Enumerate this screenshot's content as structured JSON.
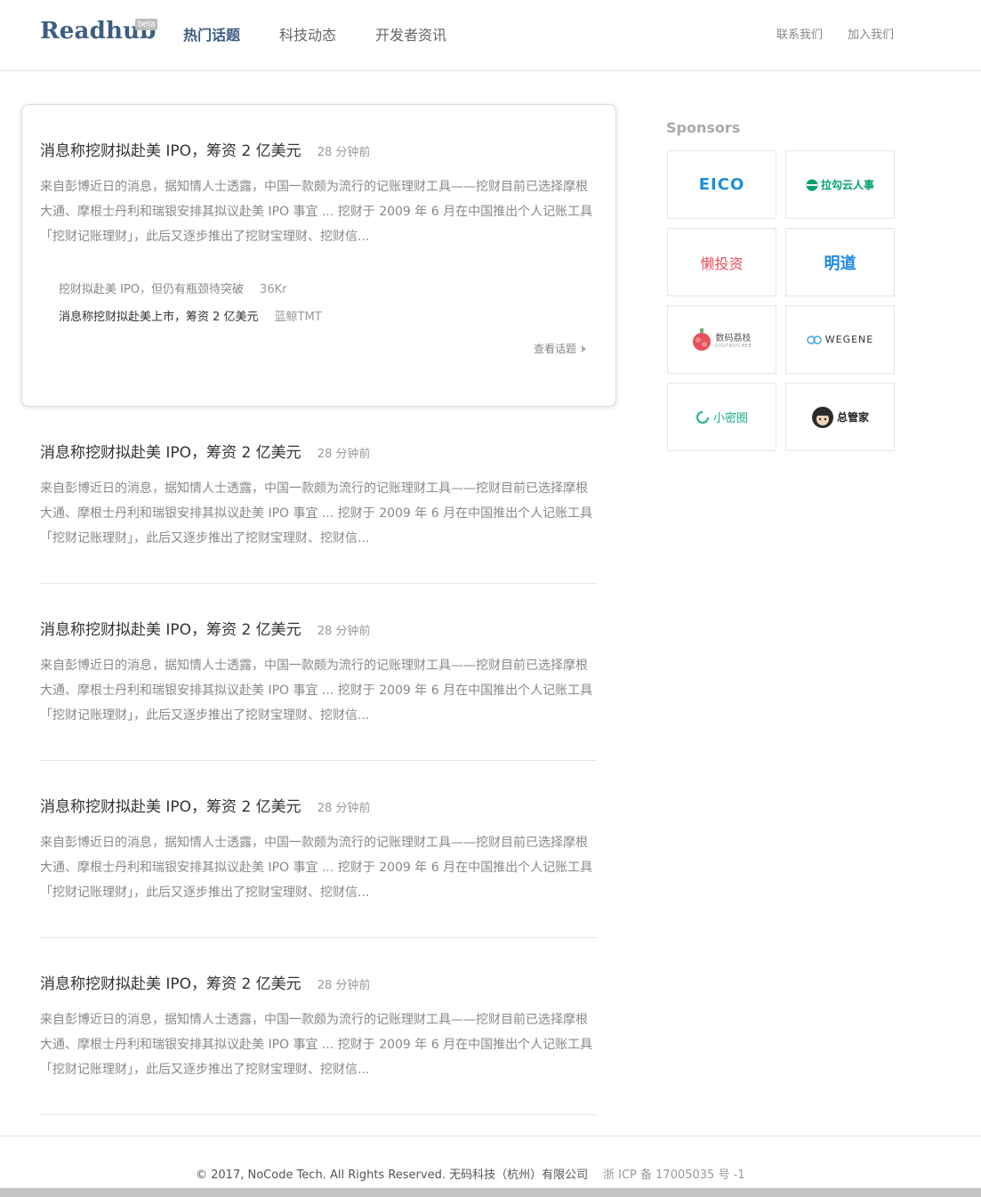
{
  "header": {
    "logo": "Readhub",
    "beta": "beta",
    "nav": [
      "热门话题",
      "科技动态",
      "开发者资讯"
    ],
    "links": [
      "联系我们",
      "加入我们"
    ]
  },
  "topics": [
    {
      "title": "消息称挖财拟赴美 IPO，筹资 2 亿美元",
      "time": "28 分钟前",
      "summary": "来自彭博近日的消息，据知情人士透露，中国一款颇为流行的记账理财工具——挖财目前已选择摩根大通、摩根士丹利和瑞银安排其拟议赴美 IPO 事宜 ... 挖财于 2009 年 6 月在中国推出个人记账工具 「挖财记账理财」，此后又逐步推出了挖财宝理财、挖财信...",
      "news": [
        {
          "title": "挖财拟赴美 IPO，但仍有瓶颈待突破",
          "source": "36Kr"
        },
        {
          "title": "消息称挖财拟赴美上市，筹资 2 亿美元",
          "source": "蓝鲸TMT"
        }
      ],
      "view_label": "查看话题"
    },
    {
      "title": "消息称挖财拟赴美 IPO，筹资 2 亿美元",
      "time": "28 分钟前",
      "summary": "来自彭博近日的消息，据知情人士透露，中国一款颇为流行的记账理财工具——挖财目前已选择摩根大通、摩根士丹利和瑞银安排其拟议赴美 IPO 事宜 ... 挖财于 2009 年 6 月在中国推出个人记账工具 「挖财记账理财」，此后又逐步推出了挖财宝理财、挖财信..."
    },
    {
      "title": "消息称挖财拟赴美 IPO，筹资 2 亿美元",
      "time": "28 分钟前",
      "summary": "来自彭博近日的消息，据知情人士透露，中国一款颇为流行的记账理财工具——挖财目前已选择摩根大通、摩根士丹利和瑞银安排其拟议赴美 IPO 事宜 ... 挖财于 2009 年 6 月在中国推出个人记账工具 「挖财记账理财」，此后又逐步推出了挖财宝理财、挖财信..."
    },
    {
      "title": "消息称挖财拟赴美 IPO，筹资 2 亿美元",
      "time": "28 分钟前",
      "summary": "来自彭博近日的消息，据知情人士透露，中国一款颇为流行的记账理财工具——挖财目前已选择摩根大通、摩根士丹利和瑞银安排其拟议赴美 IPO 事宜 ... 挖财于 2009 年 6 月在中国推出个人记账工具 「挖财记账理财」，此后又逐步推出了挖财宝理财、挖财信..."
    },
    {
      "title": "消息称挖财拟赴美 IPO，筹资 2 亿美元",
      "time": "28 分钟前",
      "summary": "来自彭博近日的消息，据知情人士透露，中国一款颇为流行的记账理财工具——挖财目前已选择摩根大通、摩根士丹利和瑞银安排其拟议赴美 IPO 事宜 ... 挖财于 2009 年 6 月在中国推出个人记账工具 「挖财记账理财」，此后又逐步推出了挖财宝理财、挖财信..."
    }
  ],
  "sponsors": {
    "title": "Sponsors",
    "items": [
      {
        "name": "EICO",
        "color": "#1a8fd9"
      },
      {
        "name": "拉勾云人事",
        "color": "#00a36c"
      },
      {
        "name": "懒投资",
        "color": "#e8505b"
      },
      {
        "name": "明道",
        "color": "#1e88e5"
      },
      {
        "name": "数码荔枝",
        "sub": "DIGITALYCHEE",
        "color": "#e8505b"
      },
      {
        "name": "WEGENE",
        "color": "#333333"
      },
      {
        "name": "小密圈",
        "color": "#1cb28a"
      },
      {
        "name": "总管家",
        "color": "#222222"
      }
    ]
  },
  "footer": {
    "copyright": "© 2017, NoCode Tech. All Rights Reserved. 无码科技（杭州）有限公司",
    "icp": "浙 ICP 备 17005035 号 -1"
  }
}
